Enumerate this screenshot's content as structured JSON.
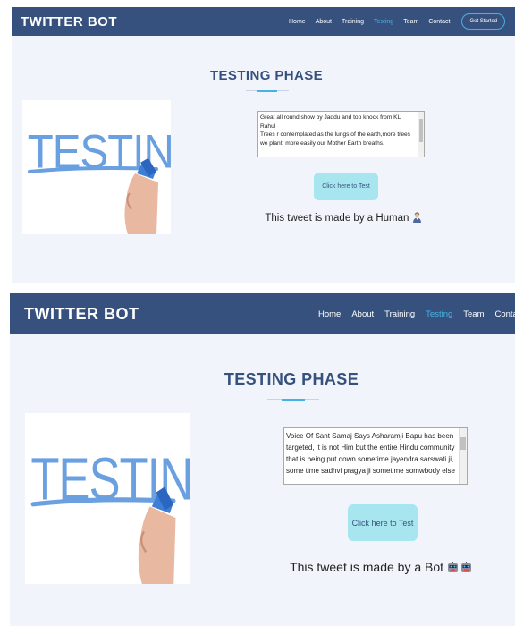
{
  "panels": [
    {
      "brand": "TWITTER BOT",
      "nav": [
        "Home",
        "About",
        "Training",
        "Testing",
        "Team",
        "Contact"
      ],
      "active_nav": "Testing",
      "cta_label": "Get Started",
      "section_title": "TESTING PHASE",
      "image_text": "TESTING",
      "tweet_text": "Great all round show by Jaddu and top knock from KL Rahul\nTrees r contemplated as the lungs of the earth,more trees we plant, more easily our Mother Earth breaths.",
      "button_label": "Click here to Test",
      "result_text": "This tweet is made by a Human",
      "result_icon": "human-emoji-icon"
    },
    {
      "brand": "TWITTER BOT",
      "nav": [
        "Home",
        "About",
        "Training",
        "Testing",
        "Team",
        "Contact"
      ],
      "active_nav": "Testing",
      "cta_label": "",
      "section_title": "TESTING PHASE",
      "image_text": "TESTING",
      "tweet_text": "Voice Of Sant Samaj Says Asharamji Bapu has been targeted, it is not Him but the entire Hindu community that is being put down sometime jayendra sarswati ji, some time sadhvi pragya ji sometime somwbody else",
      "button_label": "Click here to Test",
      "result_text": "This tweet is made by a Bot",
      "result_icon": "robot-emoji-icon"
    }
  ],
  "colors": {
    "navbar": "#37517e",
    "accent": "#47b2e4",
    "background": "#f1f4fa",
    "button": "#a8e6ef",
    "title": "#37517e",
    "marker_ink": "#6a9fe0"
  }
}
